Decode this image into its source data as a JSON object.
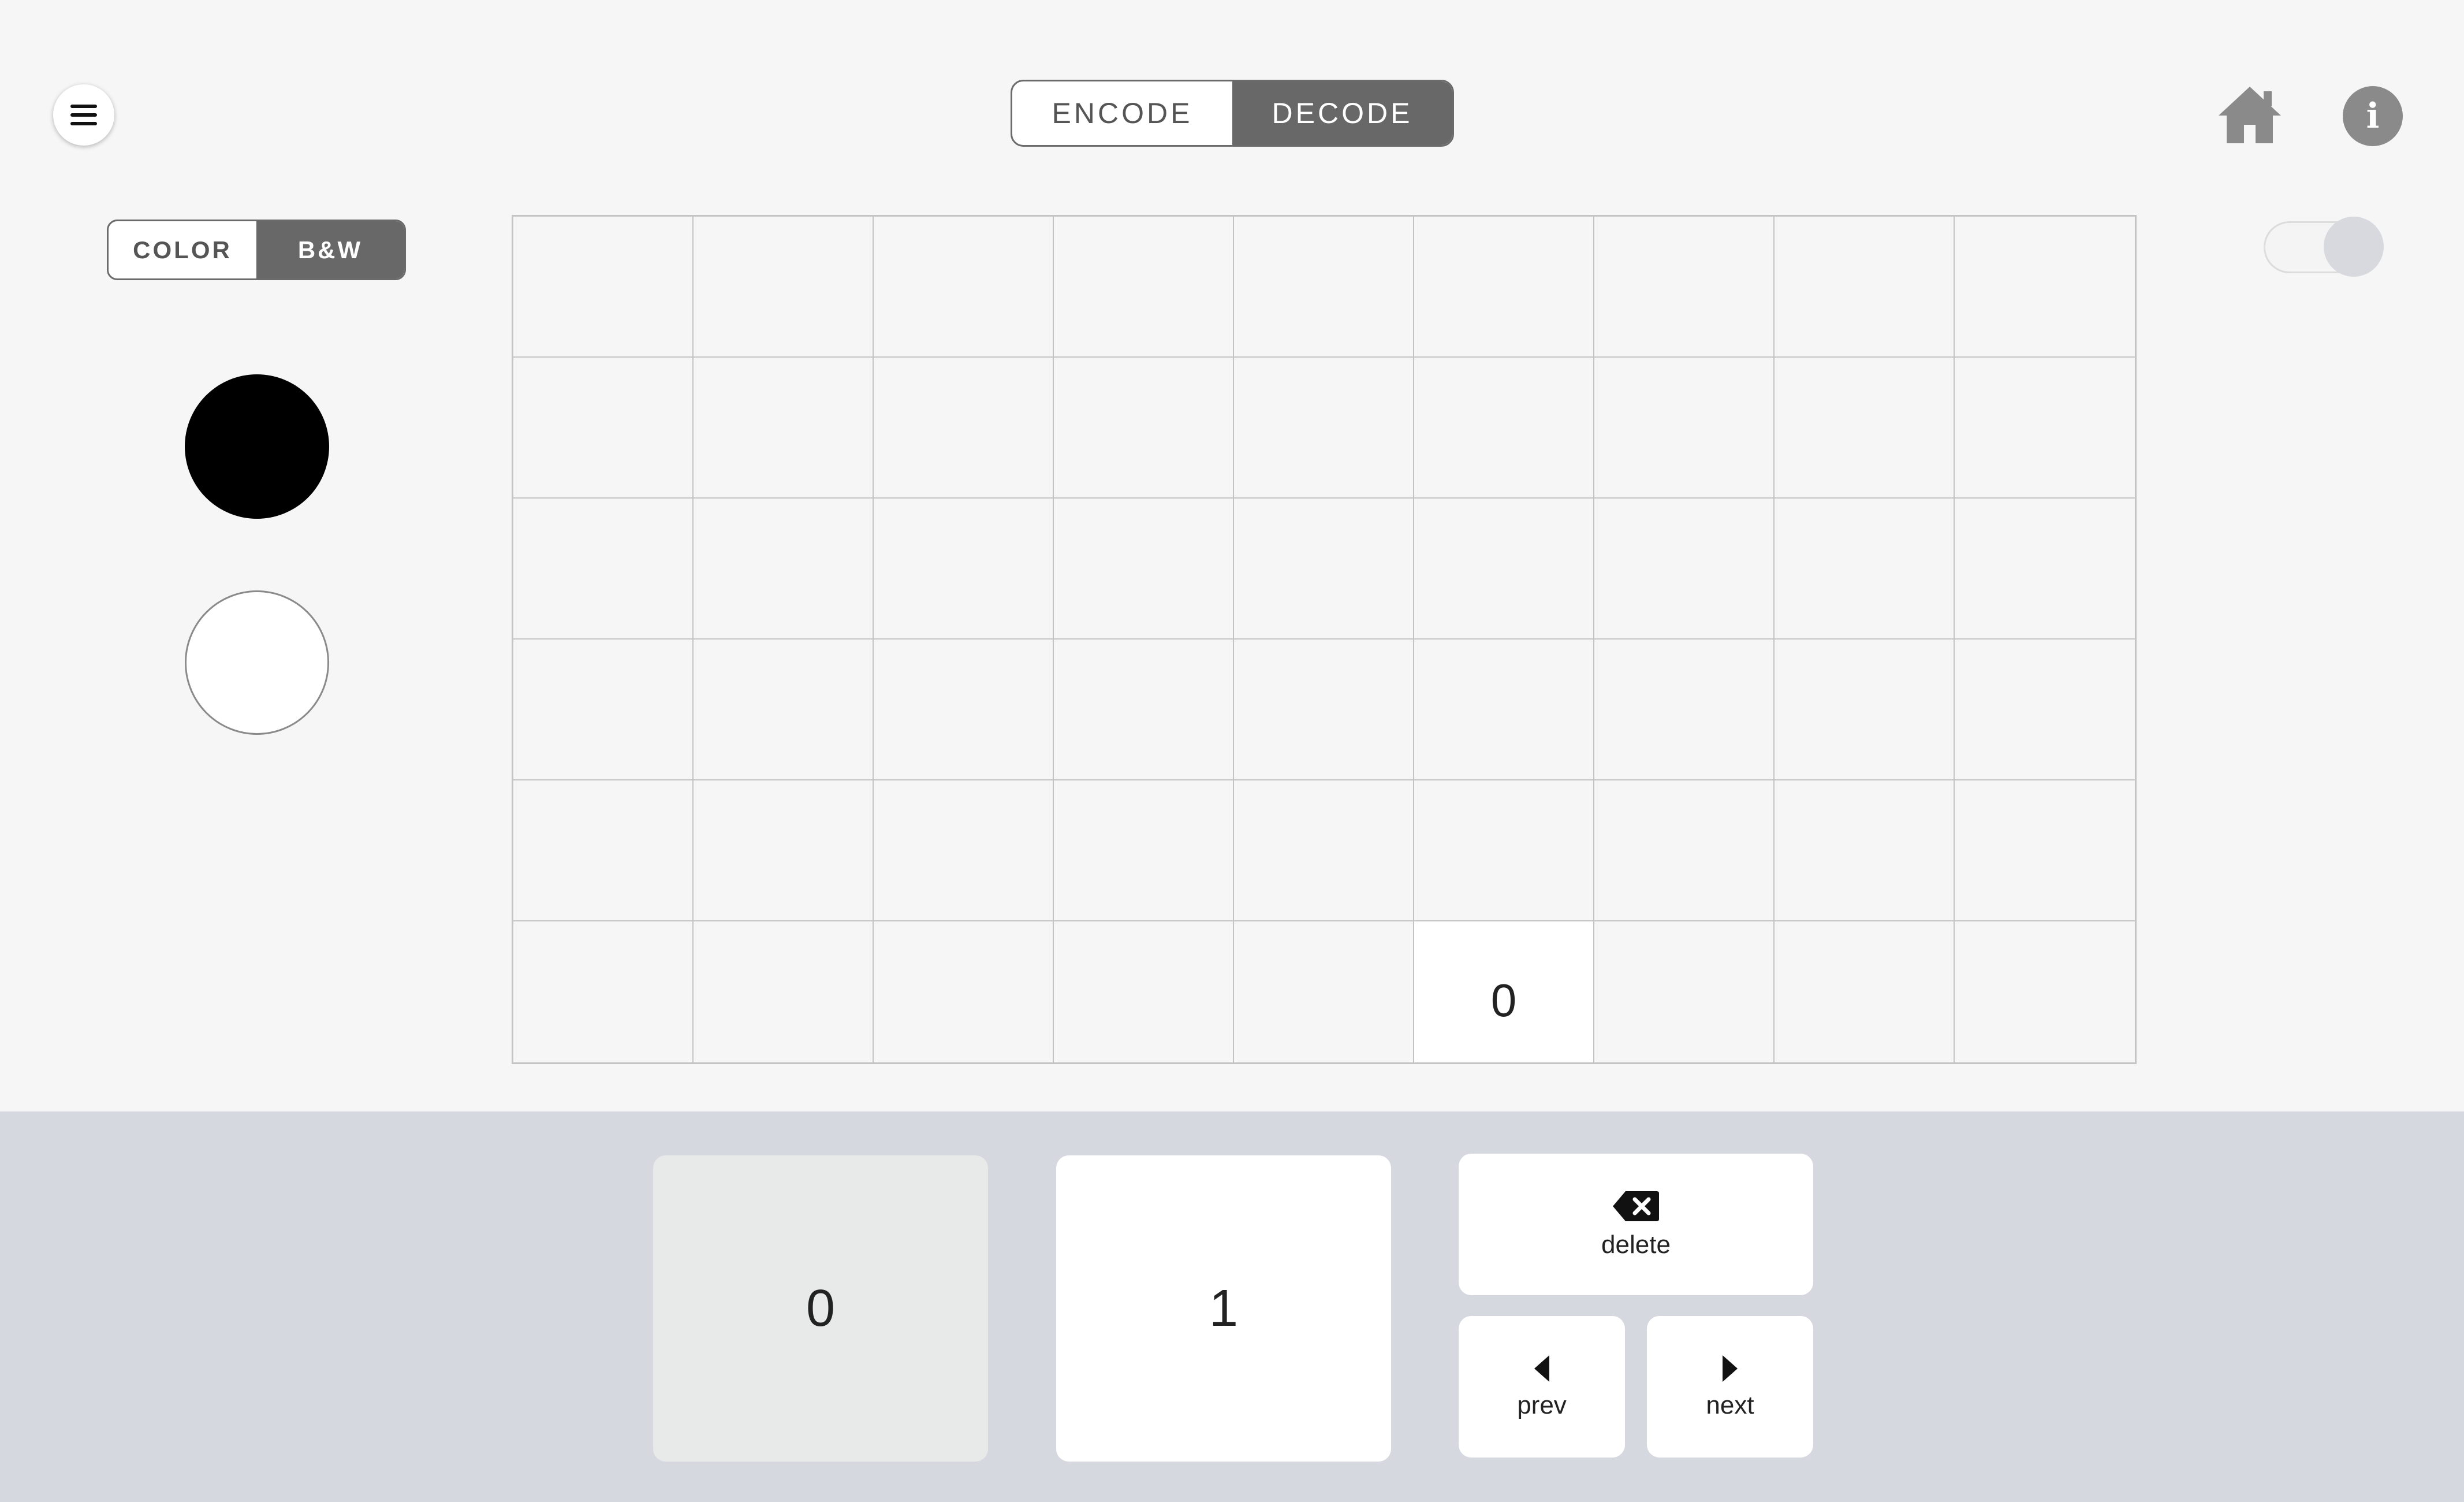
{
  "header": {
    "menu_icon": "hamburger-icon",
    "mode_tabs": [
      {
        "label": "ENCODE",
        "active": false
      },
      {
        "label": "DECODE",
        "active": true
      }
    ],
    "home_icon": "home-icon",
    "info_icon": "info-icon",
    "info_glyph": "i"
  },
  "sidebar": {
    "color_modes": [
      {
        "label": "COLOR",
        "active": false
      },
      {
        "label": "B&W",
        "active": true
      }
    ],
    "swatches": [
      {
        "name": "black",
        "color": "#000000"
      },
      {
        "name": "white",
        "color": "#ffffff"
      }
    ]
  },
  "switch": {
    "on": true
  },
  "grid": {
    "columns": 9,
    "rows": 6,
    "cells": [
      [
        "",
        "",
        "",
        "",
        "",
        "",
        "",
        "",
        ""
      ],
      [
        "",
        "",
        "",
        "",
        "",
        "",
        "",
        "",
        ""
      ],
      [
        "",
        "",
        "",
        "",
        "",
        "",
        "",
        "",
        ""
      ],
      [
        "",
        "",
        "",
        "",
        "",
        "",
        "",
        "",
        ""
      ],
      [
        "",
        "",
        "",
        "",
        "",
        "",
        "",
        "",
        ""
      ],
      [
        "",
        "",
        "",
        "",
        "",
        "0",
        "",
        "",
        ""
      ]
    ],
    "selected_cell": {
      "row": 5,
      "col": 5
    }
  },
  "keypad": {
    "zero": "0",
    "one": "1",
    "delete_label": "delete",
    "prev_label": "prev",
    "next_label": "next"
  },
  "colors": {
    "background": "#f6f6f6",
    "active_segment": "#686868",
    "keypad_background": "#d6d8df"
  }
}
